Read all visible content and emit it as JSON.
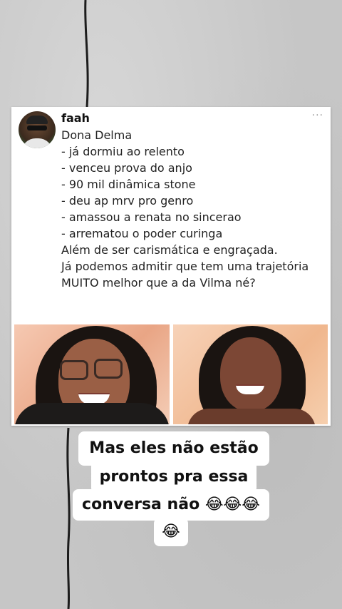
{
  "post": {
    "user_name": "faah",
    "more_label": "···",
    "title": "Dona Delma",
    "list": [
      "- já dormiu ao relento",
      "- venceu prova do anjo",
      "- 90 mil dinâmica stone",
      "- deu ap mrv pro genro",
      "- amassou a renata no sincerao",
      "- arrematou o poder curinga"
    ],
    "closing": [
      "Além de ser carismática e engraçada.",
      "Já podemos admitir que tem uma trajetória",
      "MUITO melhor que a da Vilma né?"
    ]
  },
  "caption": {
    "lines": [
      "Mas eles não estão",
      "prontos pra essa",
      "conversa não 😂😂😂",
      "😂"
    ]
  }
}
